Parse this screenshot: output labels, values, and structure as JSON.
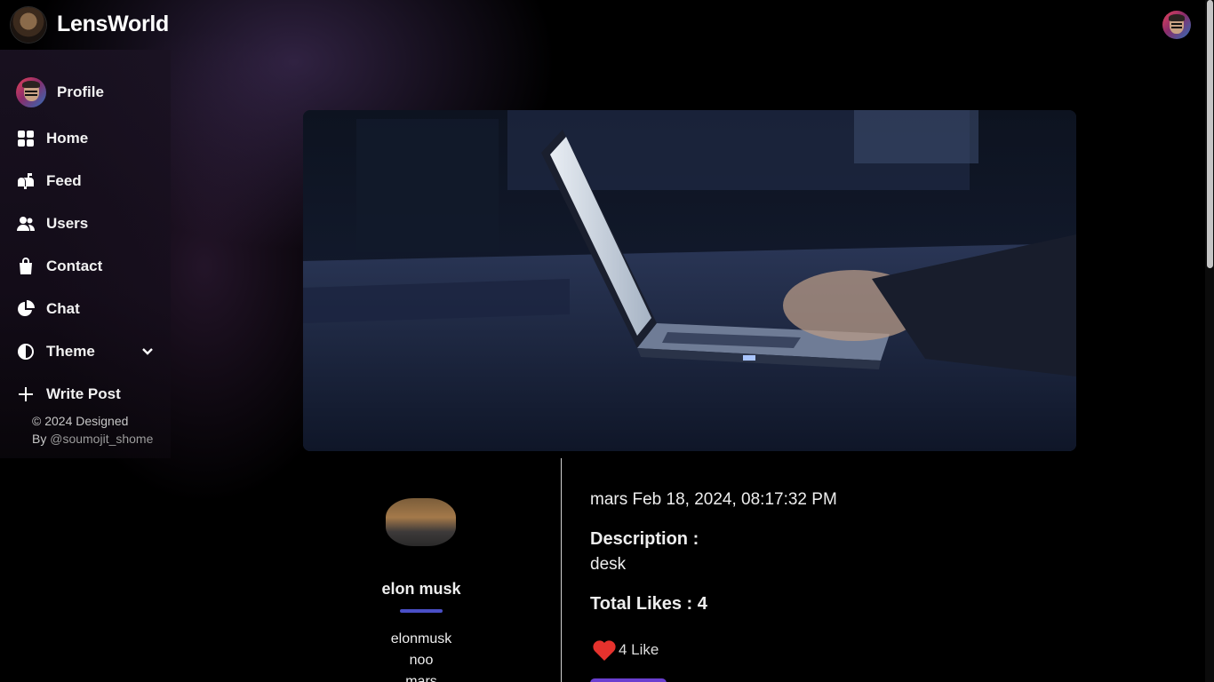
{
  "app": {
    "brand": "LensWorld"
  },
  "sidebar": {
    "items": [
      {
        "label": "Profile",
        "icon": "profile-avatar"
      },
      {
        "label": "Home",
        "icon": "grid-icon"
      },
      {
        "label": "Feed",
        "icon": "mailbox-icon"
      },
      {
        "label": "Users",
        "icon": "users-icon"
      },
      {
        "label": "Contact",
        "icon": "shopping-bag-icon"
      },
      {
        "label": "Chat",
        "icon": "pie-chart-icon"
      },
      {
        "label": "Theme",
        "icon": "contrast-icon"
      },
      {
        "label": "Write Post",
        "icon": "plus-icon"
      }
    ],
    "copyright": "© 2024 Designed",
    "copyright_by": "By",
    "copyright_handle": "@soumojit_shome"
  },
  "post": {
    "image_alt": "laptop on desk at night",
    "author": {
      "name": "elon musk",
      "username": "elonmusk",
      "bio": "noo",
      "location": "mars"
    },
    "timestamp": "mars Feb 18, 2024, 08:17:32 PM",
    "description_label": "Description :",
    "description": "desk",
    "total_likes_label": "Total Likes : 4",
    "like_button": "4 Like"
  },
  "colors": {
    "accent": "#4a4fc7",
    "heart": "#e5322d",
    "button": "#6a3fd0",
    "background": "#000000"
  }
}
